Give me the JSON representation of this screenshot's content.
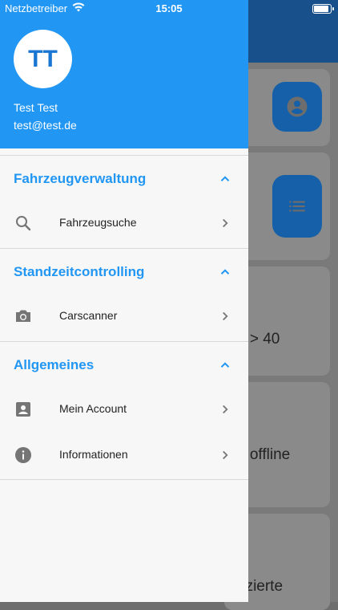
{
  "status_bar": {
    "carrier": "Netzbetreiber",
    "time": "15:05"
  },
  "background": {
    "texts": [
      "e > 40",
      "e offline",
      "uzierte"
    ]
  },
  "drawer": {
    "user": {
      "initials": "TT",
      "name": "Test Test",
      "email": "test@test.de"
    },
    "sections": [
      {
        "title": "Fahrzeugverwaltung",
        "items": [
          {
            "label": "Fahrzeugsuche",
            "icon": "search-icon"
          }
        ]
      },
      {
        "title": "Standzeitcontrolling",
        "items": [
          {
            "label": "Carscanner",
            "icon": "camera-icon"
          }
        ]
      },
      {
        "title": "Allgemeines",
        "items": [
          {
            "label": "Mein Account",
            "icon": "account-box-icon"
          },
          {
            "label": "Informationen",
            "icon": "info-icon"
          }
        ]
      }
    ]
  },
  "colors": {
    "primary": "#2196f3",
    "app_bar": "#1565c0",
    "icon_grey": "#757575"
  }
}
